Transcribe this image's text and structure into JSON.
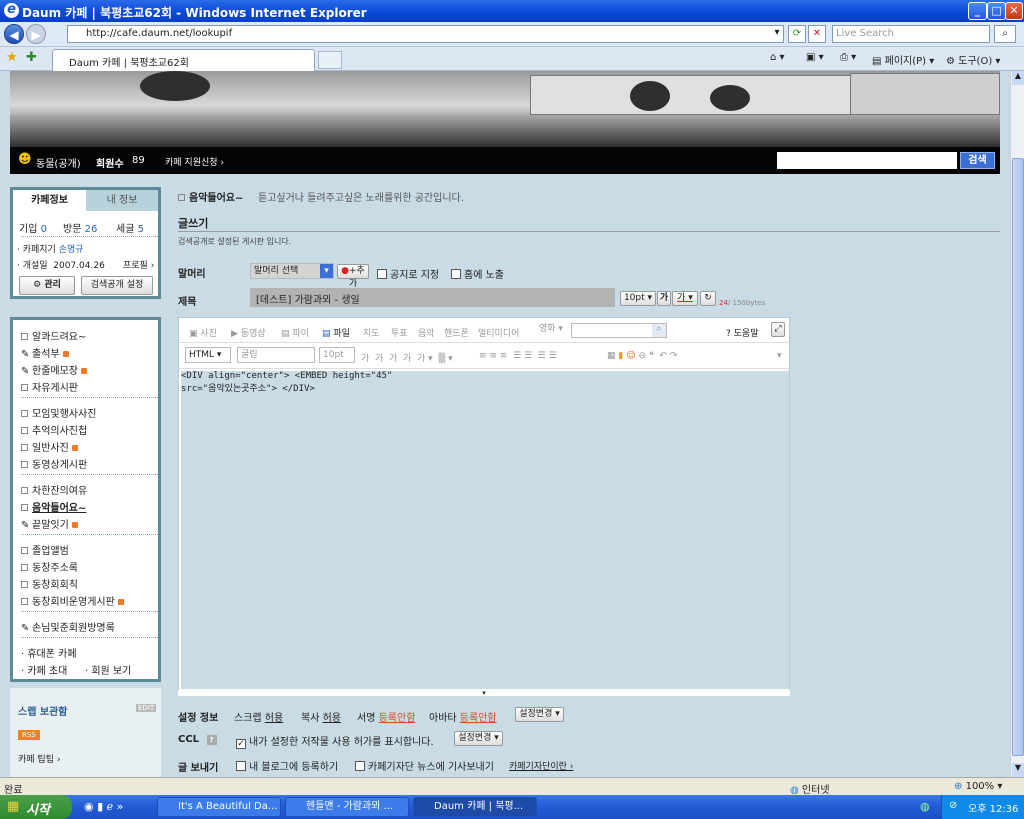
{
  "window": {
    "title": "Daum 카페 | 북평초교62회 - Windows Internet Explorer"
  },
  "nav": {
    "url": "http://cafe.daum.net/lookupif",
    "search_placeholder": "Live Search"
  },
  "tabs": {
    "active_label": "Daum 카페 | 북평초교62회"
  },
  "ie_toolbar": {
    "page_label": "페이지(P)",
    "tools_label": "도구(O)"
  },
  "cafe": {
    "name": "동물(공개)",
    "members_label": "회원수",
    "members_count": "89",
    "support_link": "카페 지원신청 ›",
    "search_button": "검색"
  },
  "info": {
    "tab_cafe": "카페정보",
    "tab_mine": "내 정보",
    "join_label": "기입",
    "join_value": "0",
    "visit_label": "방문",
    "visit_value": "26",
    "posts_label": "세글",
    "posts_value": "5",
    "manager_label": "· 카페지기",
    "manager_name": "손명규",
    "opened_label": "· 개설일",
    "opened_date": "2007.04.26",
    "profile_link": "프로필 ›",
    "admin_button": "관리",
    "search_setting_button": "검색공개 설정"
  },
  "menu": {
    "items": [
      "알콰드려요~",
      "출석부",
      "한줄메모장",
      "자유게시판",
      "모임및행사사진",
      "추억의사진첩",
      "일반사진",
      "동영상게시판",
      "차한잔의여유",
      "음악들어요~",
      "끝말잇기",
      "졸업앨범",
      "동창주소록",
      "동창회회칙",
      "동창회비운영게시판",
      "손님및준회원방명록"
    ],
    "mobile": "· 휴대폰 카페",
    "invite": "· 카페 초대",
    "members_view": "· 회원 보기"
  },
  "scrap": {
    "title": "스랩 보관함",
    "edit": "EDIT",
    "rss": "RSS",
    "tip": "카페 팁팁 ›"
  },
  "board": {
    "name": "음악들어요~",
    "desc": "듣고싶거나 들려주고싶은 노래를위한 공간입니다."
  },
  "write": {
    "heading": "글쓰기",
    "subtitle": "검색공개로 설정된 게시판 입니다.",
    "header_label": "말머리",
    "header_select": "말머리 선택",
    "add_button": "+추가",
    "notice_check": "공지로 지정",
    "home_check": "홈에 노출",
    "title_label": "제목",
    "title_value": "[데스트] 가람과뫼 - 생일",
    "font_size": "10pt",
    "bold": "가",
    "underline": "가",
    "byte_count": "24",
    "byte_max": "/ 150bytes"
  },
  "editor": {
    "tools_row1": [
      "사진",
      "동영상",
      "파이",
      "파일",
      "지도",
      "투표",
      "음악",
      "핸드폰",
      "멀티미디어"
    ],
    "extra_select": "영화",
    "help": "도움말",
    "mode": "HTML",
    "font": "굴림",
    "size": "10pt",
    "content_line1": "<DIV align=\"center\"> <EMBED height=\"45\"",
    "content_line2": "src=\"음악있는곳주소\"> </DIV>"
  },
  "settings": {
    "label": "설정 정보",
    "scrap_label": "스크랩",
    "scrap_value": "허용",
    "copy_label": "복사",
    "copy_value": "허용",
    "sign_label": "서명",
    "sign_value": "등록안함",
    "avatar_label": "아바타",
    "avatar_value": "등록안함",
    "change_button": "설정변경",
    "ccl_label": "CCL",
    "ccl_text": "내가 설정한 저작물 사용 허가를 표시합니다.",
    "send_label": "글 보내기",
    "blog_text": "내 블로그에 등록하기",
    "news_text": "카페기자단 뉴스에 기사보내기",
    "news_link": "카페기자단이란 ›"
  },
  "status": {
    "left": "완료",
    "zone": "인터넷",
    "zoom": "100%"
  },
  "taskbar": {
    "start": "시작",
    "tasks": [
      "It's A Beautiful Da...",
      "헨들맨 - 가람과뫼 ...",
      "Daum 카페 | 북평..."
    ],
    "clock": "오후 12:36"
  }
}
